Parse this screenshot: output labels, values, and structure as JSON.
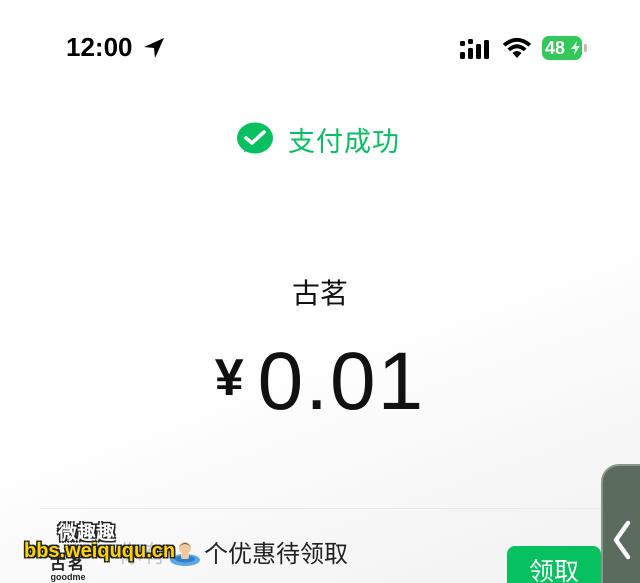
{
  "status_bar": {
    "time": "12:00",
    "battery_level": "48",
    "icons": [
      "location-arrow-icon",
      "cellular-signal-icon",
      "wifi-icon",
      "battery-charging-icon"
    ]
  },
  "payment": {
    "status_text": "支付成功",
    "merchant": "古茗",
    "currency_symbol": "¥",
    "amount": "0.01"
  },
  "coupon": {
    "brand_name_cn": "古茗",
    "brand_name_en": "goodme",
    "text_prefix": "你有",
    "text_suffix": "个优惠待领取",
    "claim_label": "领取"
  },
  "watermark": {
    "title": "微趣趣",
    "url": "bbs.weiququ.cn"
  },
  "colors": {
    "wechat_green": "#07c160",
    "battery_green": "#34c759"
  }
}
